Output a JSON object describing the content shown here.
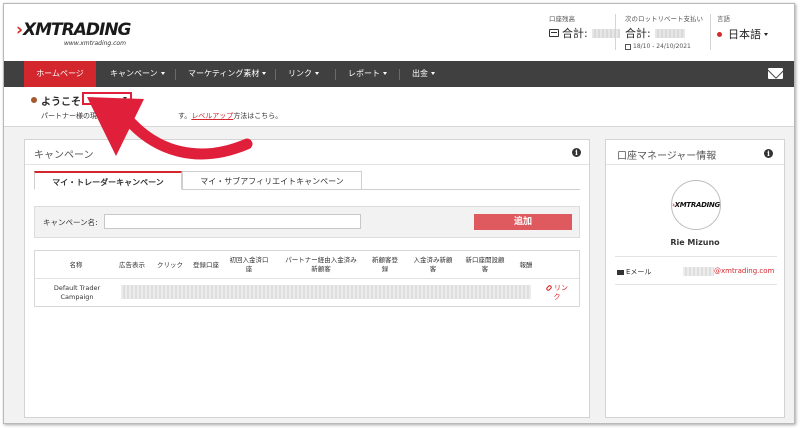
{
  "brand": {
    "logo_text": "XMTRADING",
    "logo_chevron": "›",
    "logo_url": "www.xmtrading.com",
    "accent": "#d3262d"
  },
  "header": {
    "account_label": "口座残高",
    "account_total": "合計:",
    "rebate_label": "次のロットリベート支払い",
    "rebate_total": "合計:",
    "rebate_period": "18/10 - 24/10/2021",
    "language_label": "言語",
    "language_value": "日本語"
  },
  "nav": {
    "items": [
      {
        "label": "ホームページ"
      },
      {
        "label": "キャンペーン"
      },
      {
        "label": "マーケティング素材"
      },
      {
        "label": "リンク"
      },
      {
        "label": "レポート"
      },
      {
        "label": "出金"
      }
    ],
    "mail_icon": "envelope-icon"
  },
  "welcome": {
    "title": "ようこそ",
    "sub_prefix": "パートナー様の現在のレ",
    "sub_mid": "す。",
    "sub_link": "レベルアップ",
    "sub_suffix": "方法はこちら。"
  },
  "campaign": {
    "title": "キャンペーン",
    "tabs": [
      {
        "label": "マイ・トレーダーキャンペーン",
        "active": true
      },
      {
        "label": "マイ・サブアフィリエイトキャンペーン",
        "active": false
      }
    ],
    "search_label": "キャンペーン名:",
    "add_button": "追加",
    "columns": [
      "名称",
      "広告表示",
      "クリック",
      "登録口座",
      "初回入金済口座",
      "パートナー経由入金済み新顧客",
      "新顧客登録",
      "入金済み新顧客",
      "新口座開設顧客",
      "報酬"
    ],
    "rows": [
      {
        "name": "Default Trader Campaign",
        "link_label": "リンク"
      }
    ]
  },
  "manager": {
    "title": "口座マネージャー情報",
    "logo_text": "XMTRADING",
    "name": "Rie Mizuno",
    "email_label": "Eメール",
    "email_value": "@xmtrading.com"
  }
}
